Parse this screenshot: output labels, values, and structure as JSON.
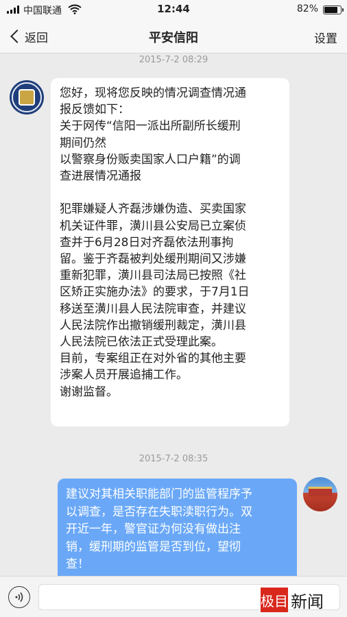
{
  "status_bar": {
    "carrier": "中国联通",
    "time": "12:44",
    "battery_percent": "82%",
    "battery_level": 0.82
  },
  "nav": {
    "back_label": "返回",
    "title": "平安信阳",
    "settings_label": "设置"
  },
  "chat": {
    "messages": [
      {
        "timestamp": "2015-7-2 08:29",
        "sender": "official",
        "avatar": "police-emblem-icon",
        "text": "您好，现将您反映的情况调查情况通\n报反馈如下：\n关于网传“信阳一派出所副所长缓刑\n期间仍然\n以警察身份贩卖国家人口户籍”的调\n查进展情况通报\n\n犯罪嫌疑人齐磊涉嫌伪造、买卖国家\n机关证件罪，潢川县公安局已立案侦\n查并于6月28日对齐磊依法刑事拘\n留。鉴于齐磊被判处缓刑期间又涉嫌\n重新犯罪，潢川县司法局已按照《社\n区矫正实施办法》的要求，于7月1日\n移送至潢川县人民法院审查，并建议\n人民法院作出撤销缓刑裁定，潢川县\n人民法院已依法正式受理此案。\n目前，专案组正在对外省的其他主要\n涉案人员开展追捕工作。\n谢谢监督。"
      },
      {
        "timestamp": "2015-7-2 08:35",
        "sender": "user",
        "avatar": "tiananmen-avatar",
        "text": "建议对其相关职能部门的监管程序予\n以调查，是否存在失职渎职行为。双\n开近一年，警官证为何没有做出注\n销，缓刑期的监管是否到位，望彻\n查！"
      }
    ]
  },
  "input_bar": {
    "voice_icon": "voice-icon",
    "placeholder": ""
  },
  "watermark": {
    "red_text": "极目",
    "black_text": "新闻"
  },
  "colors": {
    "background": "#ebebeb",
    "user_bubble": "#6aa8f7",
    "official_bubble": "#ffffff",
    "watermark_red": "#d9271c"
  }
}
